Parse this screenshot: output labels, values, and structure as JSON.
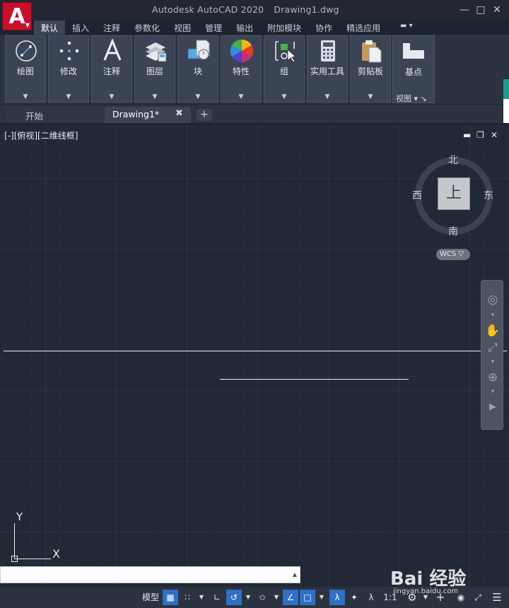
{
  "app_button": {
    "letter": "A"
  },
  "window": {
    "app_name": "Autodesk AutoCAD 2020",
    "file_name": "Drawing1.dwg"
  },
  "ribbon_tabs": [
    {
      "label": "默认",
      "active": true
    },
    {
      "label": "插入"
    },
    {
      "label": "注释"
    },
    {
      "label": "参数化"
    },
    {
      "label": "视图"
    },
    {
      "label": "管理"
    },
    {
      "label": "输出"
    },
    {
      "label": "附加模块"
    },
    {
      "label": "协作"
    },
    {
      "label": "精选应用"
    }
  ],
  "ribbon_panels": [
    {
      "label": "绘图",
      "icon": "draw-line-icon"
    },
    {
      "label": "修改",
      "icon": "move-icon"
    },
    {
      "label": "注释",
      "icon": "text-icon"
    },
    {
      "label": "图层",
      "icon": "layers-icon"
    },
    {
      "label": "块",
      "icon": "block-icon"
    },
    {
      "label": "特性",
      "icon": "color-wheel-icon"
    },
    {
      "label": "组",
      "icon": "group-icon"
    },
    {
      "label": "实用工具",
      "icon": "calculator-icon"
    },
    {
      "label": "剪贴板",
      "icon": "clipboard-icon"
    }
  ],
  "base_panel": {
    "label": "基点",
    "sub_label": "视图"
  },
  "file_tabs": {
    "start": "开始",
    "drawing": "Drawing1*"
  },
  "viewport": {
    "label": "[-][俯视][二维线框]"
  },
  "viewcube": {
    "north": "北",
    "south": "南",
    "east": "东",
    "west": "西",
    "face": "上",
    "wcs": "WCS"
  },
  "ucs": {
    "x_label": "X",
    "y_label": "Y"
  },
  "statusbar": {
    "model": "模型",
    "scale": "1:1"
  },
  "watermark": {
    "text": "Bai 经验",
    "sub": "jingyan.baidu.com"
  },
  "colors": {
    "accent": "#2f6fc4",
    "app_red": "#c8102e",
    "background": "#212836"
  }
}
